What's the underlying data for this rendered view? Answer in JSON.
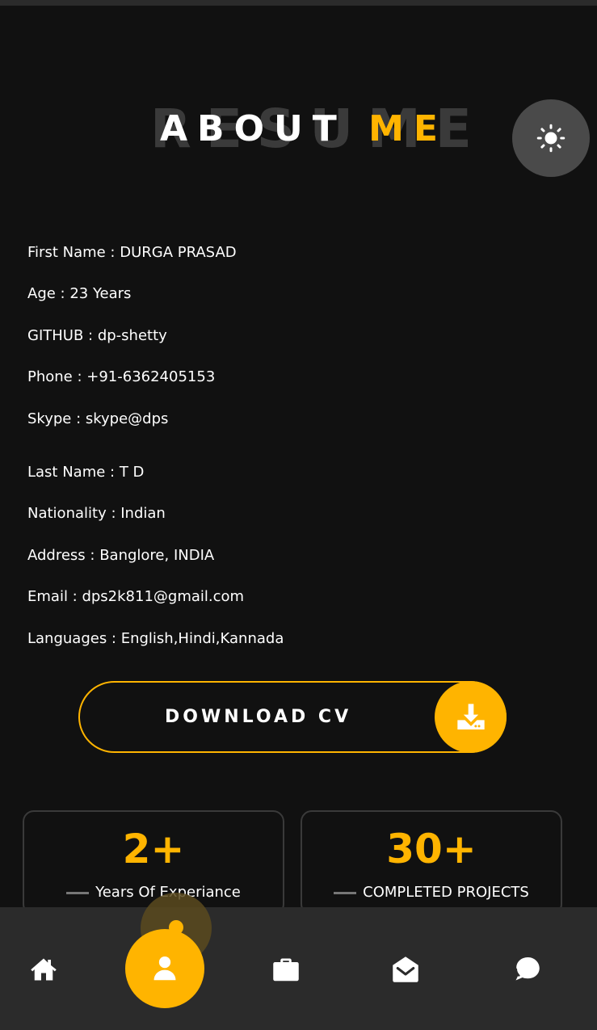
{
  "heading": {
    "background_text": "RESUME",
    "title_main": "ABOUT",
    "title_accent": "ME"
  },
  "theme_toggle": {
    "icon": "sun-icon"
  },
  "info": {
    "first_name": "First Name : DURGA PRASAD",
    "age": "Age : 23 Years",
    "github": "GITHUB : dp-shetty",
    "phone": "Phone : +91-6362405153",
    "skype": "Skype : skype@dps",
    "last_name": "Last Name : T D",
    "nationality": "Nationality : Indian",
    "address": "Address : Banglore, INDIA",
    "email": "Email : dps2k811@gmail.com",
    "languages": "Languages : English,Hindi,Kannada"
  },
  "download": {
    "label": "DOWNLOAD CV",
    "icon": "download-icon"
  },
  "stats": [
    {
      "value": "2+",
      "label": "Years Of Experiance"
    },
    {
      "value": "30+",
      "label": "COMPLETED PROJECTS"
    }
  ],
  "bottom_nav": {
    "items": [
      {
        "icon": "home-icon"
      },
      {
        "icon": "user-icon",
        "active": true
      },
      {
        "icon": "briefcase-icon"
      },
      {
        "icon": "mail-open-icon"
      },
      {
        "icon": "chat-icon"
      }
    ]
  },
  "colors": {
    "accent": "#ffb400",
    "background": "#111111",
    "nav_background": "#2b2b2b"
  }
}
